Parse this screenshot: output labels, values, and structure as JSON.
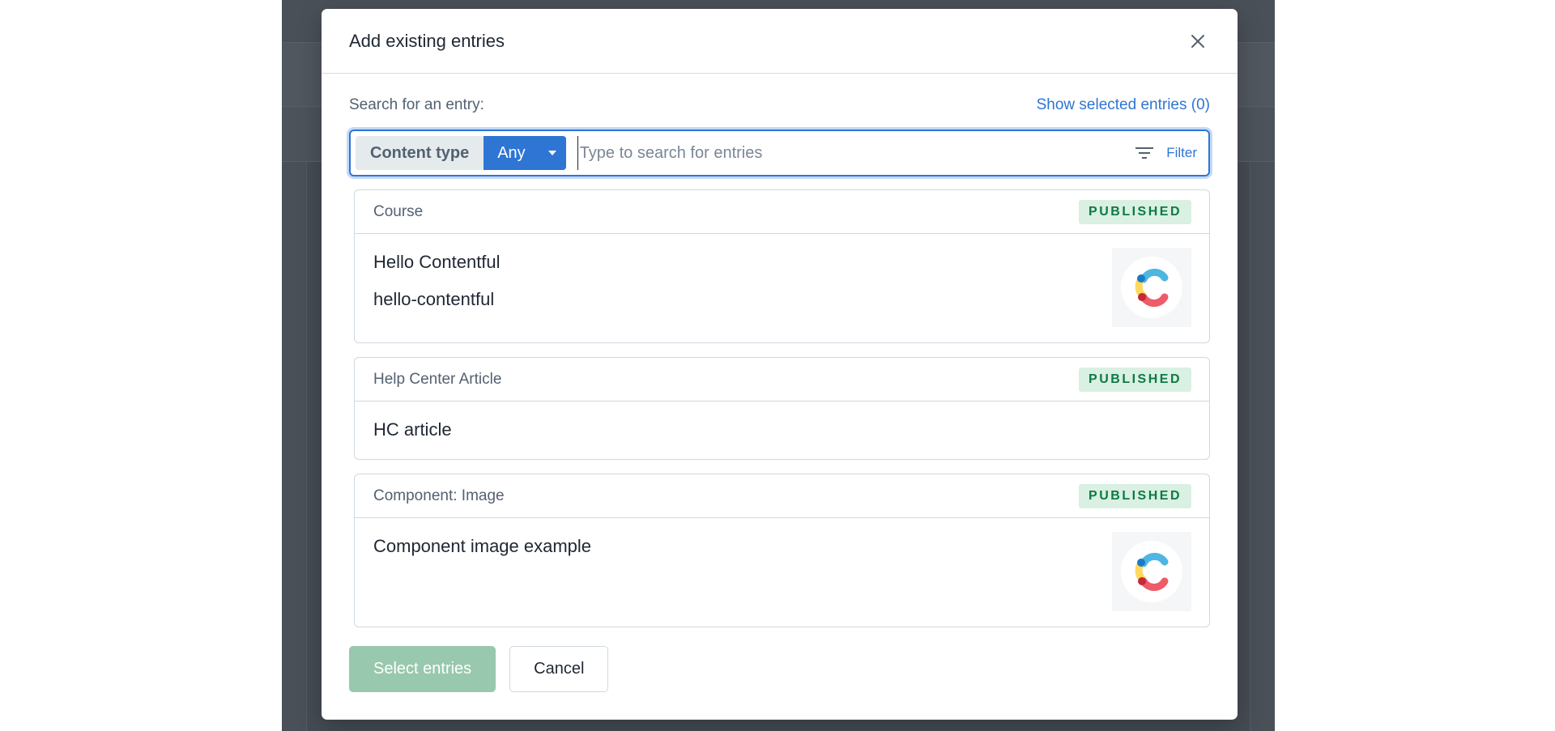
{
  "modal": {
    "title": "Add existing entries",
    "close_icon": "close-icon"
  },
  "search": {
    "label": "Search for an entry:",
    "show_selected": "Show selected entries (0)",
    "content_type_label": "Content type",
    "content_type_value": "Any",
    "placeholder": "Type to search for entries",
    "value": "",
    "filter_label": "Filter",
    "filter_icon": "filter-icon"
  },
  "entries": [
    {
      "type": "Course",
      "status": "PUBLISHED",
      "title": "Hello Contentful",
      "description": "hello-contentful",
      "has_thumbnail": true
    },
    {
      "type": "Help Center Article",
      "status": "PUBLISHED",
      "title": "HC article",
      "description": "",
      "has_thumbnail": false
    },
    {
      "type": "Component: Image",
      "status": "PUBLISHED",
      "title": "Component image example",
      "description": "",
      "has_thumbnail": true
    }
  ],
  "footer": {
    "select_label": "Select entries",
    "cancel_label": "Cancel"
  },
  "colors": {
    "accent": "#2e75d4",
    "published_text": "#0e7a43",
    "published_bg": "#d9f0e3",
    "primary_disabled": "#98c8ad",
    "overlay": "#4a5058"
  }
}
